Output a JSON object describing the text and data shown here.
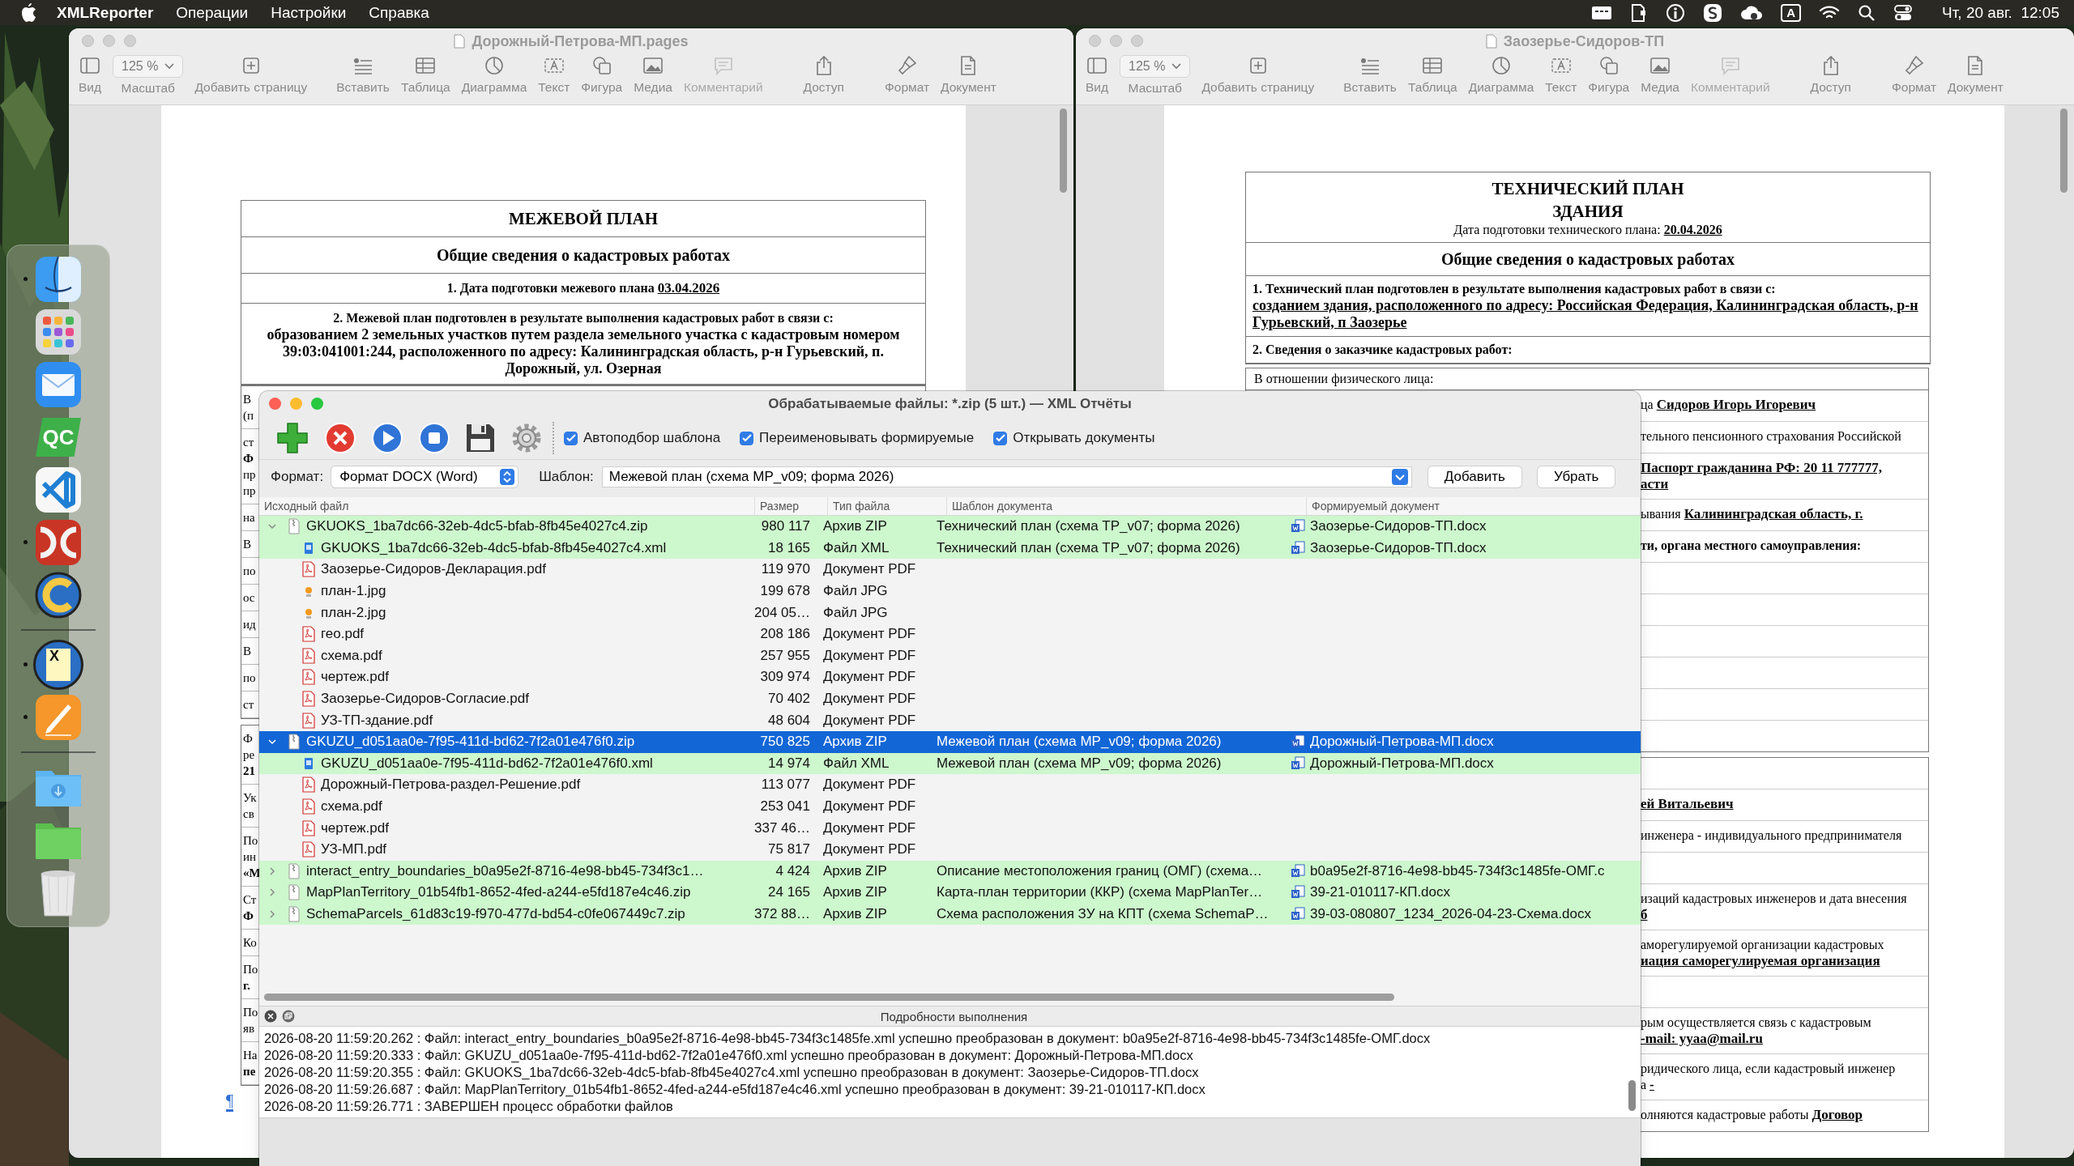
{
  "menu_bar": {
    "app_name": "XMLReporter",
    "menus": [
      "Операции",
      "Настройки",
      "Справка"
    ],
    "input_source": "A",
    "clock": "Чт, 20 авг.  12:05"
  },
  "dock": {
    "items": [
      {
        "kind": "finder",
        "running": true
      },
      {
        "kind": "launchpad",
        "running": false
      },
      {
        "kind": "mail",
        "running": false
      },
      {
        "kind": "qc",
        "text": "QC",
        "running": false
      },
      {
        "kind": "vscode",
        "running": false
      },
      {
        "kind": "dc",
        "running": true
      },
      {
        "kind": "wrench",
        "running": false
      },
      {
        "kind": "separator"
      },
      {
        "kind": "xmlreporter",
        "text": "X",
        "running": true
      },
      {
        "kind": "pages",
        "running": true
      },
      {
        "kind": "separator"
      },
      {
        "kind": "downloads",
        "running": false
      },
      {
        "kind": "folder",
        "running": false
      },
      {
        "kind": "trash",
        "running": false
      }
    ]
  },
  "left_window": {
    "title": "Дорожный-Петрова-МП.pages",
    "zoom": "125 %",
    "toolbar": [
      {
        "label": "Вид",
        "kind": "sidebar",
        "disabled": false
      },
      {
        "label": "Масштаб",
        "kind": "zoom",
        "disabled": false
      },
      {
        "label": "Добавить страницу",
        "kind": "add-page",
        "disabled": false
      },
      {
        "label": "Вставить",
        "kind": "insert",
        "disabled": false
      },
      {
        "label": "Таблица",
        "kind": "table",
        "disabled": false
      },
      {
        "label": "Диаграмма",
        "kind": "chart",
        "disabled": false
      },
      {
        "label": "Текст",
        "kind": "text",
        "disabled": false
      },
      {
        "label": "Фигура",
        "kind": "shape",
        "disabled": false
      },
      {
        "label": "Медиа",
        "kind": "media",
        "disabled": false
      },
      {
        "label": "Комментарий",
        "kind": "comment",
        "disabled": true
      },
      {
        "label": "Доступ",
        "kind": "share",
        "disabled": false
      },
      {
        "label": "Формат",
        "kind": "format",
        "disabled": false
      },
      {
        "label": "Документ",
        "kind": "document",
        "disabled": false
      }
    ],
    "document": {
      "title": "МЕЖЕВОЙ ПЛАН",
      "section": "Общие сведения о кадастровых работах",
      "rows": [
        {
          "kind": "inline",
          "label": "1. Дата подготовки межевого плана",
          "value": "03.04.2026"
        },
        {
          "kind": "block",
          "label": "2. Межевой план подготовлен в результате выполнения кадастровых работ в связи с:",
          "value": "образованием 2 земельных участков путем раздела земельного участка с кадастровым номером 39:03:041001:244, расположенного по адресу: Калининградская область, р-н Гурьевский, п. Дорожный, ул. Озерная"
        }
      ],
      "cut_tables": [
        [
          [
            "В",
            "(п"
          ],
          [
            "ст",
            "**Ф**",
            "пр",
            "пр"
          ],
          [
            "на"
          ],
          [
            "В"
          ],
          [
            "по"
          ],
          [
            "ос"
          ],
          [
            "ид"
          ],
          [
            "В"
          ],
          [
            "по"
          ],
          [
            "ст"
          ]
        ],
        [
          [
            "Ф",
            "ре",
            "**21**"
          ],
          [
            "Ук",
            "св"
          ],
          [
            "По",
            "ин",
            "**«М**"
          ],
          [
            "Ст",
            "**Ф**"
          ],
          [
            "Ко"
          ],
          [
            "По",
            "**г.**"
          ],
          [
            "По",
            "яв"
          ],
          [
            "На",
            "**пе**"
          ]
        ]
      ],
      "paragraph_mark": "¶"
    }
  },
  "right_window": {
    "title": "Заозерье-Сидоров-ТП",
    "zoom": "125 %",
    "toolbar": [
      {
        "label": "Вид",
        "kind": "sidebar",
        "disabled": false
      },
      {
        "label": "Масштаб",
        "kind": "zoom",
        "disabled": false
      },
      {
        "label": "Добавить страницу",
        "kind": "add-page",
        "disabled": false
      },
      {
        "label": "Вставить",
        "kind": "insert",
        "disabled": false
      },
      {
        "label": "Таблица",
        "kind": "table",
        "disabled": false
      },
      {
        "label": "Диаграмма",
        "kind": "chart",
        "disabled": false
      },
      {
        "label": "Текст",
        "kind": "text",
        "disabled": false
      },
      {
        "label": "Фигура",
        "kind": "shape",
        "disabled": false
      },
      {
        "label": "Медиа",
        "kind": "media",
        "disabled": false
      },
      {
        "label": "Комментарий",
        "kind": "comment",
        "disabled": true
      },
      {
        "label": "Доступ",
        "kind": "share",
        "disabled": false
      },
      {
        "label": "Формат",
        "kind": "format",
        "disabled": false
      },
      {
        "label": "Документ",
        "kind": "document",
        "disabled": false
      }
    ],
    "document": {
      "title_lines": [
        "ТЕХНИЧЕСКИЙ ПЛАН",
        "ЗДАНИЯ"
      ],
      "date_label": "Дата подготовки технического плана:",
      "date": "20.04.2026",
      "section": "Общие сведения о кадастровых работах",
      "item_1": {
        "label": "1. Технический план подготовлен в результате выполнения кадастровых работ в связи с:",
        "value": "созданием здания, расположенного по адресу: Российская Федерация, Калининградская область, р-н Гурьевский, п Заозерье"
      },
      "item_2": "2. Сведения о заказчике кадастровых работ:",
      "subheading": "В отношении физического лица:",
      "cut_tables": [
        [
          {
            "kind": "text",
            "lines": [
              "ца **Сидоров Игорь Игоревич**"
            ]
          },
          {
            "kind": "text",
            "lines": [
              "тельного пенсионного страхования Российской"
            ]
          },
          {
            "kind": "text",
            "lines": [
              "**Паспорт гражданина РФ: 20 11 777777,**",
              "**асти**"
            ]
          },
          {
            "kind": "text",
            "lines": [
              "ывания **Калининградская область, г.**"
            ]
          },
          {
            "kind": "heading",
            "lines": [
              "ти, органа местного самоуправления:"
            ]
          },
          {
            "kind": "blank"
          },
          {
            "kind": "blank"
          },
          {
            "kind": "blank"
          },
          {
            "kind": "blank"
          },
          {
            "kind": "blank"
          },
          {
            "kind": "blank"
          }
        ],
        [
          {
            "kind": "blank"
          },
          {
            "kind": "text",
            "lines": [
              "**ей Витальевич**"
            ]
          },
          {
            "kind": "text",
            "lines": [
              "инженера - индивидуального предпринимателя"
            ]
          },
          {
            "kind": "blank"
          },
          {
            "kind": "text",
            "lines": [
              "изаций кадастровых инженеров и дата внесения",
              "**б**"
            ]
          },
          {
            "kind": "text",
            "lines": [
              "аморегулируемой организации кадастровых",
              "**иация саморегулируемая организация**"
            ]
          },
          {
            "kind": "blank"
          },
          {
            "kind": "text",
            "lines": [
              "рым осуществляется связь с кадастровым",
              "**-mail: yyaa@mail.ru**"
            ]
          },
          {
            "kind": "text",
            "lines": [
              "ридического лица, если кадастровый инженер",
              "а **-**"
            ]
          },
          {
            "kind": "text",
            "lines": [
              "олняются кадастровые работы **Договор**"
            ]
          }
        ]
      ]
    }
  },
  "dialog": {
    "title": "Обрабатываемые файлы: *.zip (5 шт.) — XML Отчёты",
    "tools": [
      {
        "kind": "add"
      },
      {
        "kind": "cancel"
      },
      {
        "kind": "play"
      },
      {
        "kind": "stop"
      },
      {
        "kind": "save"
      },
      {
        "kind": "settings"
      }
    ],
    "options": [
      {
        "label": "Автоподбор шаблона",
        "checked": true
      },
      {
        "label": "Переименовывать формируемые",
        "checked": true
      },
      {
        "label": "Открывать документы",
        "checked": true
      }
    ],
    "format_label": "Формат:",
    "format": "Формат DOCX (Word)",
    "template_label": "Шаблон:",
    "template": "Межевой план (схема MP_v09; форма 2026)",
    "add_button": "Добавить",
    "remove_button": "Убрать",
    "columns": [
      "Исходный файл",
      "Размер",
      "Тип файла",
      "Шаблон документа",
      "Формируемый документ"
    ],
    "files": [
      {
        "name": "GKUOKS_1ba7dc66-32eb-4dc5-bfab-8fb45e4027c4.zip",
        "size": "980 117",
        "type": "Архив ZIP",
        "kind": "zip",
        "template": "Технический план (схема TP_v07; форма 2026)",
        "output": "Заозерье-Сидоров-ТП.docx",
        "expanded": true,
        "selected": false,
        "converted": true,
        "children": [
          {
            "name": "GKUOKS_1ba7dc66-32eb-4dc5-bfab-8fb45e4027c4.xml",
            "size": "18 165",
            "type": "Файл XML",
            "kind": "xml",
            "template": "Технический план (схема TP_v07; форма 2026)",
            "output": "Заозерье-Сидоров-ТП.docx",
            "selected": false,
            "converted": true
          },
          {
            "name": "Заозерье-Сидоров-Декларация.pdf",
            "size": "119 970",
            "type": "Документ PDF",
            "kind": "pdf",
            "selected": false,
            "converted": false
          },
          {
            "name": "план-1.jpg",
            "size": "199 678",
            "type": "Файл JPG",
            "kind": "jpg",
            "selected": false,
            "converted": false
          },
          {
            "name": "план-2.jpg",
            "size": "204 05…",
            "type": "Файл JPG",
            "kind": "jpg",
            "selected": false,
            "converted": false
          },
          {
            "name": "гео.pdf",
            "size": "208 186",
            "type": "Документ PDF",
            "kind": "pdf",
            "selected": false,
            "converted": false
          },
          {
            "name": "схема.pdf",
            "size": "257 955",
            "type": "Документ PDF",
            "kind": "pdf",
            "selected": false,
            "converted": false
          },
          {
            "name": "чертеж.pdf",
            "size": "309 974",
            "type": "Документ PDF",
            "kind": "pdf",
            "selected": false,
            "converted": false
          },
          {
            "name": "Заозерье-Сидоров-Согласие.pdf",
            "size": "70 402",
            "type": "Документ PDF",
            "kind": "pdf",
            "selected": false,
            "converted": false
          },
          {
            "name": "УЗ-ТП-здание.pdf",
            "size": "48 604",
            "type": "Документ PDF",
            "kind": "pdf",
            "selected": false,
            "converted": false
          }
        ]
      },
      {
        "name": "GKUZU_d051aa0e-7f95-411d-bd62-7f2a01e476f0.zip",
        "size": "750 825",
        "type": "Архив ZIP",
        "kind": "zip",
        "template": "Межевой план (схема MP_v09; форма 2026)",
        "output": "Дорожный-Петрова-МП.docx",
        "expanded": true,
        "selected": true,
        "converted": true,
        "children": [
          {
            "name": "GKUZU_d051aa0e-7f95-411d-bd62-7f2a01e476f0.xml",
            "size": "14 974",
            "type": "Файл XML",
            "kind": "xml",
            "template": "Межевой план (схема MP_v09; форма 2026)",
            "output": "Дорожный-Петрова-МП.docx",
            "selected": false,
            "converted": true
          },
          {
            "name": "Дорожный-Петрова-раздел-Решение.pdf",
            "size": "113 077",
            "type": "Документ PDF",
            "kind": "pdf",
            "selected": false,
            "converted": false
          },
          {
            "name": "схема.pdf",
            "size": "253 041",
            "type": "Документ PDF",
            "kind": "pdf",
            "selected": false,
            "converted": false
          },
          {
            "name": "чертеж.pdf",
            "size": "337 46…",
            "type": "Документ PDF",
            "kind": "pdf",
            "selected": false,
            "converted": false
          },
          {
            "name": "УЗ-МП.pdf",
            "size": "75 817",
            "type": "Документ PDF",
            "kind": "pdf",
            "selected": false,
            "converted": false
          }
        ]
      },
      {
        "name": "interact_entry_boundaries_b0a95e2f-8716-4e98-bb45-734f3c1…",
        "size": "4 424",
        "type": "Архив ZIP",
        "kind": "zip",
        "template": "Описание местоположения границ (ОМГ) (схема…",
        "output": "b0a95e2f-8716-4e98-bb45-734f3c1485fe-ОМГ.c",
        "expanded": false,
        "selected": false,
        "converted": true
      },
      {
        "name": "MapPlanTerritory_01b54fb1-8652-4fed-a244-e5fd187e4c46.zip",
        "size": "24 165",
        "type": "Архив ZIP",
        "kind": "zip",
        "template": "Карта-план территории (ККР) (схема MapPlanTer…",
        "output": "39-21-010117-КП.docx",
        "expanded": false,
        "selected": false,
        "converted": true
      },
      {
        "name": "SchemaParcels_61d83c19-f970-477d-bd54-c0fe067449c7.zip",
        "size": "372 88…",
        "type": "Архив ZIP",
        "kind": "zip",
        "template": "Схема расположения ЗУ на КПТ (схема SchemaP…",
        "output": "39-03-080807_1234_2026-04-23-Схема.docx",
        "expanded": false,
        "selected": false,
        "converted": true
      }
    ],
    "log_title": "Подробности выполнения",
    "log": [
      "2026-08-20 11:59:20.262 : Файл: interact_entry_boundaries_b0a95e2f-8716-4e98-bb45-734f3c1485fe.xml успешно преобразован в документ: b0a95e2f-8716-4e98-bb45-734f3c1485fe-ОМГ.docx",
      "2026-08-20 11:59:20.333 : Файл: GKUZU_d051aa0e-7f95-411d-bd62-7f2a01e476f0.xml успешно преобразован в документ: Дорожный-Петрова-МП.docx",
      "2026-08-20 11:59:20.355 : Файл: GKUOKS_1ba7dc66-32eb-4dc5-bfab-8fb45e4027c4.xml успешно преобразован в документ: Заозерье-Сидоров-ТП.docx",
      "2026-08-20 11:59:26.687 : Файл: MapPlanTerritory_01b54fb1-8652-4fed-a244-e5fd187e4c46.xml успешно преобразован в документ: 39-21-010117-КП.docx",
      "2026-08-20 11:59:26.771 : ЗАВЕРШЕН процесс обработки файлов"
    ]
  }
}
